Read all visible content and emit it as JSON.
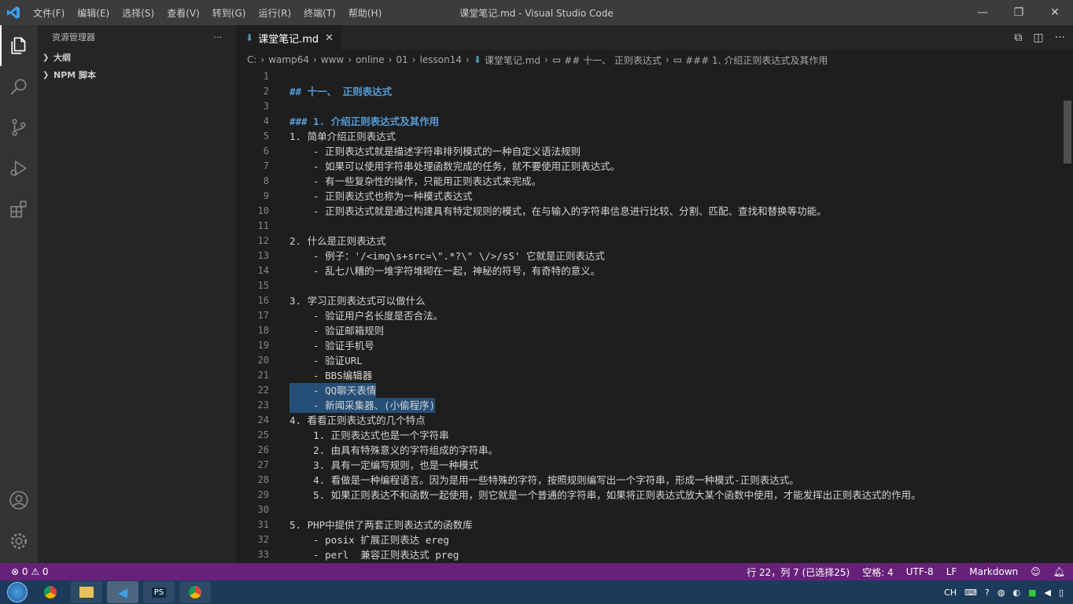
{
  "app": {
    "title": "课堂笔记.md - Visual Studio Code",
    "menu": [
      "文件(F)",
      "编辑(E)",
      "选择(S)",
      "查看(V)",
      "转到(G)",
      "运行(R)",
      "终端(T)",
      "帮助(H)"
    ]
  },
  "sidebar": {
    "title": "资源管理器",
    "more": "···",
    "sections": [
      "大纲",
      "NPM 脚本"
    ]
  },
  "tab": {
    "label": "课堂笔记.md",
    "close": "✕"
  },
  "breadcrumb": [
    "C:",
    "wamp64",
    "www",
    "online",
    "01",
    "lesson14",
    "课堂笔记.md",
    "## 十一、 正则表达式",
    "### 1. 介绍正则表达式及其作用"
  ],
  "editor": {
    "lines": [
      {
        "n": "1",
        "text": ""
      },
      {
        "n": "2",
        "text": "## 十一、 正则表达式"
      },
      {
        "n": "3",
        "text": ""
      },
      {
        "n": "4",
        "text": "### 1. 介绍正则表达式及其作用"
      },
      {
        "n": "5",
        "text": "1. 简单介绍正则表达式"
      },
      {
        "n": "6",
        "text": "    - 正则表达式就是描述字符串排列模式的一种自定义语法规则"
      },
      {
        "n": "7",
        "text": "    - 如果可以使用字符串处理函数完成的任务，就不要使用正则表达式。"
      },
      {
        "n": "8",
        "text": "    - 有一些复杂性的操作，只能用正则表达式来完成。"
      },
      {
        "n": "9",
        "text": "    - 正则表达式也称为一种模式表达式"
      },
      {
        "n": "10",
        "text": "    - 正则表达式就是通过构建具有特定规则的模式，在与输入的字符串信息进行比较、分割、匹配、查找和替换等功能。"
      },
      {
        "n": "11",
        "text": ""
      },
      {
        "n": "12",
        "text": "2. 什么是正则表达式"
      },
      {
        "n": "13",
        "text": "    - 例子：'/<img\\s+src=\\\".*?\\\" \\/>/sS' 它就是正则表达式"
      },
      {
        "n": "14",
        "text": "    - 乱七八糟的一堆字符堆砌在一起，神秘的符号，有奇特的意义。"
      },
      {
        "n": "15",
        "text": ""
      },
      {
        "n": "16",
        "text": "3. 学习正则表达式可以做什么"
      },
      {
        "n": "17",
        "text": "    - 验证用户名长度是否合法。"
      },
      {
        "n": "18",
        "text": "    - 验证邮箱规则"
      },
      {
        "n": "19",
        "text": "    - 验证手机号"
      },
      {
        "n": "20",
        "text": "    - 验证URL"
      },
      {
        "n": "21",
        "text": "    - BBS编辑器"
      },
      {
        "n": "22",
        "text": "    - QQ聊天表情"
      },
      {
        "n": "23",
        "text": "    - 新闻采集器、(小偷程序)"
      },
      {
        "n": "24",
        "text": "4. 看看正则表达式的几个特点"
      },
      {
        "n": "25",
        "text": "    1. 正则表达式也是一个字符串"
      },
      {
        "n": "26",
        "text": "    2. 由具有特殊意义的字符组成的字符串。"
      },
      {
        "n": "27",
        "text": "    3. 具有一定编写规则，也是一种模式"
      },
      {
        "n": "28",
        "text": "    4. 看做是一种编程语言。因为是用一些特殊的字符，按照规则编写出一个字符串，形成一种模式-正则表达式。"
      },
      {
        "n": "29",
        "text": "    5. 如果正则表达不和函数一起使用，则它就是一个普通的字符串，如果将正则表达式放大某个函数中使用，才能发挥出正则表达式的作用。"
      },
      {
        "n": "30",
        "text": ""
      },
      {
        "n": "31",
        "text": "5. PHP中提供了两套正则表达式的函数库"
      },
      {
        "n": "32",
        "text": "    - posix 扩展正则表达 ereg"
      },
      {
        "n": "33",
        "text": "    - perl  兼容正则表达式 preg"
      }
    ]
  },
  "status": {
    "problems": "⊗ 0 ⚠ 0",
    "position": "行 22，列 7 (已选择25)",
    "spaces": "空格: 4",
    "encoding": "UTF-8",
    "eol": "LF",
    "language": "Markdown"
  },
  "taskbar": {
    "apps": [
      "chrome",
      "files",
      "vscode",
      "PS",
      "chrome2"
    ],
    "tray_lang": "CH"
  },
  "colors": {
    "statusbar": "#68217a",
    "accent": "#007acc"
  }
}
